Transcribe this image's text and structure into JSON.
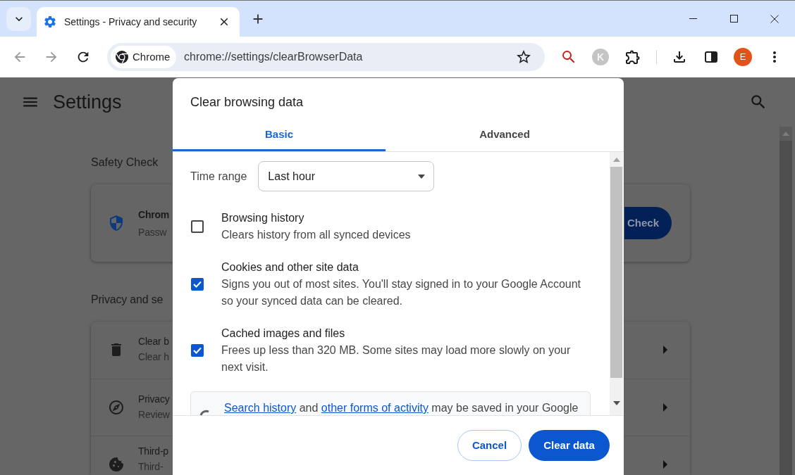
{
  "browser": {
    "tabs": [
      {
        "title": "Settings - Privacy and security",
        "selected": true
      }
    ],
    "nav_buttons": [
      {
        "kind": "back",
        "disabled": true
      },
      {
        "kind": "forward",
        "disabled": true
      },
      {
        "kind": "reload",
        "disabled": false
      }
    ],
    "address_bar": {
      "chip": "Chrome",
      "url": "chrome://settings/clearBrowserData"
    },
    "extension_letter": "K",
    "profile_initial": "E"
  },
  "settings_page": {
    "title": "Settings",
    "safety_check": {
      "heading": "Safety Check",
      "title": "Chrom",
      "subtitle": "Passw",
      "button": "Check"
    },
    "privacy": {
      "heading": "Privacy and se",
      "rows": [
        {
          "kind": "trash",
          "title": "Clear b",
          "subtitle": "Clear h"
        },
        {
          "kind": "compass",
          "title": "Privacy",
          "subtitle": "Review"
        },
        {
          "kind": "cookie",
          "title": "Third-p",
          "subtitle": "Third-"
        }
      ]
    }
  },
  "dialog": {
    "title": "Clear browsing data",
    "tabs": [
      {
        "label": "Basic",
        "selected": true
      },
      {
        "label": "Advanced",
        "selected": false
      }
    ],
    "time_range": {
      "label": "Time range",
      "value": "Last hour"
    },
    "options": [
      {
        "title": "Browsing history",
        "description": "Clears history from all synced devices",
        "checked": false
      },
      {
        "title": "Cookies and other site data",
        "description": "Signs you out of most sites. You'll stay signed in to your Google Account so your synced data can be cleared.",
        "checked": true
      },
      {
        "title": "Cached images and files",
        "description": "Frees up less than 320 MB. Some sites may load more slowly on your next visit.",
        "checked": true
      }
    ],
    "notice": [
      {
        "kind": "link",
        "text": "Search history"
      },
      {
        "kind": "text",
        "text": " and "
      },
      {
        "kind": "link",
        "text": "other forms of activity"
      },
      {
        "kind": "text",
        "text": " may be saved in your Google"
      }
    ],
    "buttons": [
      {
        "kind": "secondary",
        "label": "Cancel"
      },
      {
        "kind": "primary",
        "label": "Clear data"
      }
    ]
  }
}
